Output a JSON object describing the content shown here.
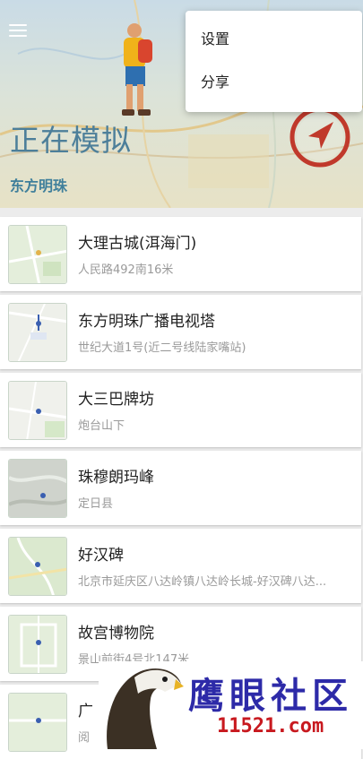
{
  "header": {
    "title": "正在模拟",
    "subtitle": "东方明珠"
  },
  "menu": {
    "items": [
      {
        "label": "设置"
      },
      {
        "label": "分享"
      }
    ]
  },
  "places": [
    {
      "name": "大理古城(洱海门)",
      "address": "人民路492南16米"
    },
    {
      "name": "东方明珠广播电视塔",
      "address": "世纪大道1号(近二号线陆家嘴站)"
    },
    {
      "name": "大三巴牌坊",
      "address": "炮台山下"
    },
    {
      "name": "珠穆朗玛峰",
      "address": "定日县"
    },
    {
      "name": "好汉碑",
      "address": "北京市延庆区八达岭镇八达岭长城-好汉碑八达..."
    },
    {
      "name": "故宫博物院",
      "address": "景山前街4号北147米"
    },
    {
      "name": "广",
      "address": "阅"
    }
  ],
  "watermark": {
    "text": "鹰眼社区",
    "url": "11521.com"
  },
  "colors": {
    "accent": "#3f7f9b",
    "compass_ring": "#c0392b",
    "map_green": "#dbe9cf"
  }
}
